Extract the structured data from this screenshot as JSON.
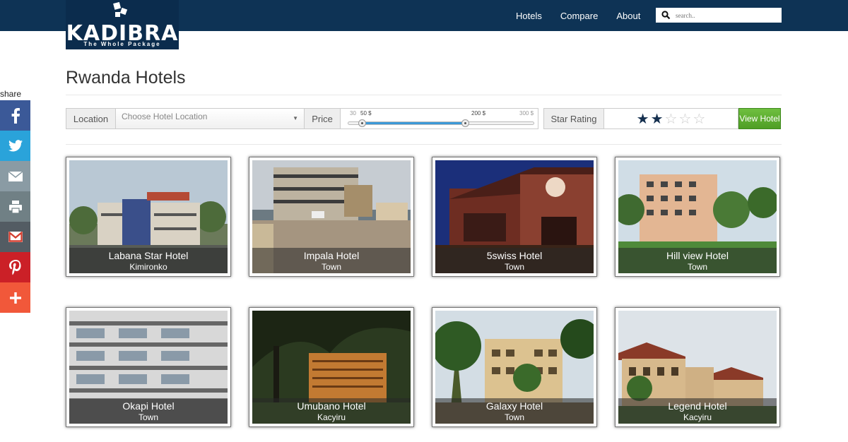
{
  "brand": {
    "name": "KADIBRA",
    "tagline": "The Whole Package"
  },
  "nav": {
    "items": [
      "Hotels",
      "Compare",
      "About"
    ]
  },
  "search": {
    "placeholder": "search.."
  },
  "share": {
    "label": "share",
    "buttons": [
      {
        "icon": "facebook-icon",
        "color": "#3b5998"
      },
      {
        "icon": "twitter-icon",
        "color": "#2aa3da"
      },
      {
        "icon": "email-icon",
        "color": "#8a9ba4"
      },
      {
        "icon": "print-icon",
        "color": "#708085"
      },
      {
        "icon": "gmail-icon",
        "color": "#535c63"
      },
      {
        "icon": "pinterest-icon",
        "color": "#cb2027"
      },
      {
        "icon": "more-icon",
        "color": "#f1583a"
      }
    ]
  },
  "page": {
    "title": "Rwanda Hotels"
  },
  "filters": {
    "location_label": "Location",
    "location_placeholder": "Choose Hotel Location",
    "price_label": "Price",
    "price_min": "30",
    "price_low": "50 $",
    "price_high": "200 $",
    "price_max": "300 $",
    "price_range_values": [
      30,
      50,
      200,
      300
    ],
    "star_label": "Star Rating",
    "star_rating": 2,
    "star_max": 5,
    "view_button": "View Hotel"
  },
  "hotels": [
    {
      "name": "Labana Star Hotel",
      "location": "Kimironko"
    },
    {
      "name": "Impala Hotel",
      "location": "Town"
    },
    {
      "name": "5swiss Hotel",
      "location": "Town"
    },
    {
      "name": "Hill view Hotel",
      "location": "Town"
    },
    {
      "name": "Okapi Hotel",
      "location": "Town"
    },
    {
      "name": "Umubano Hotel",
      "location": "Kacyiru"
    },
    {
      "name": "Galaxy Hotel",
      "location": "Town"
    },
    {
      "name": "Legend Hotel",
      "location": "Kacyiru"
    }
  ],
  "colors": {
    "navbar": "#0e3355",
    "accent": "#3c99d8",
    "button": "#5aa82d",
    "star": "#15304f"
  }
}
